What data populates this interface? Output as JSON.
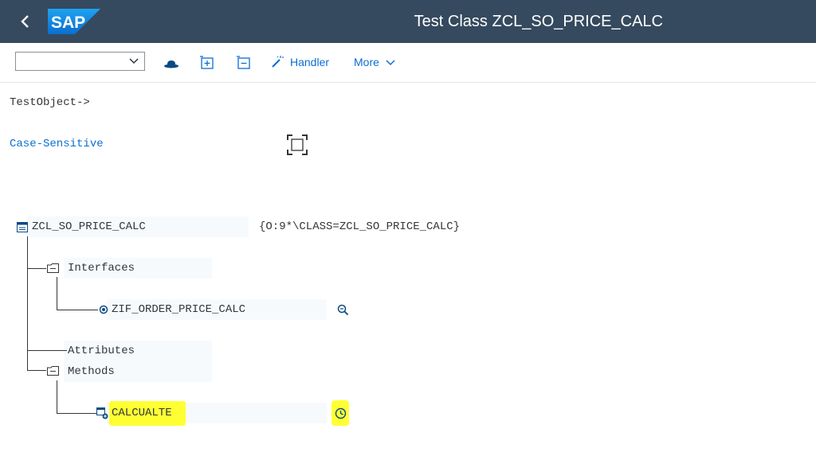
{
  "header": {
    "title": "Test Class ZCL_SO_PRICE_CALC",
    "logo_text": "SAP",
    "back_icon": "back-chevron-icon"
  },
  "toolbar": {
    "select_value": "",
    "handler_label": "Handler",
    "more_label": "More",
    "icons": [
      "hat-icon",
      "add-row-icon",
      "delete-row-icon",
      "magic-wand-icon"
    ]
  },
  "content": {
    "test_object_label": "TestObject->",
    "case_sensitive_label": "Case-Sensitive",
    "tree": {
      "root_label": "ZCL_SO_PRICE_CALC",
      "root_value": "{O:9*\\CLASS=ZCL_SO_PRICE_CALC}",
      "interfaces_label": "Interfaces",
      "interface_item": "ZIF_ORDER_PRICE_CALC",
      "attributes_label": "Attributes",
      "methods_label": "Methods",
      "method_item": "CALCUALTE"
    }
  },
  "colors": {
    "shell": "#354a5f",
    "accent": "#0a6ed1",
    "highlight": "#ffff33"
  }
}
